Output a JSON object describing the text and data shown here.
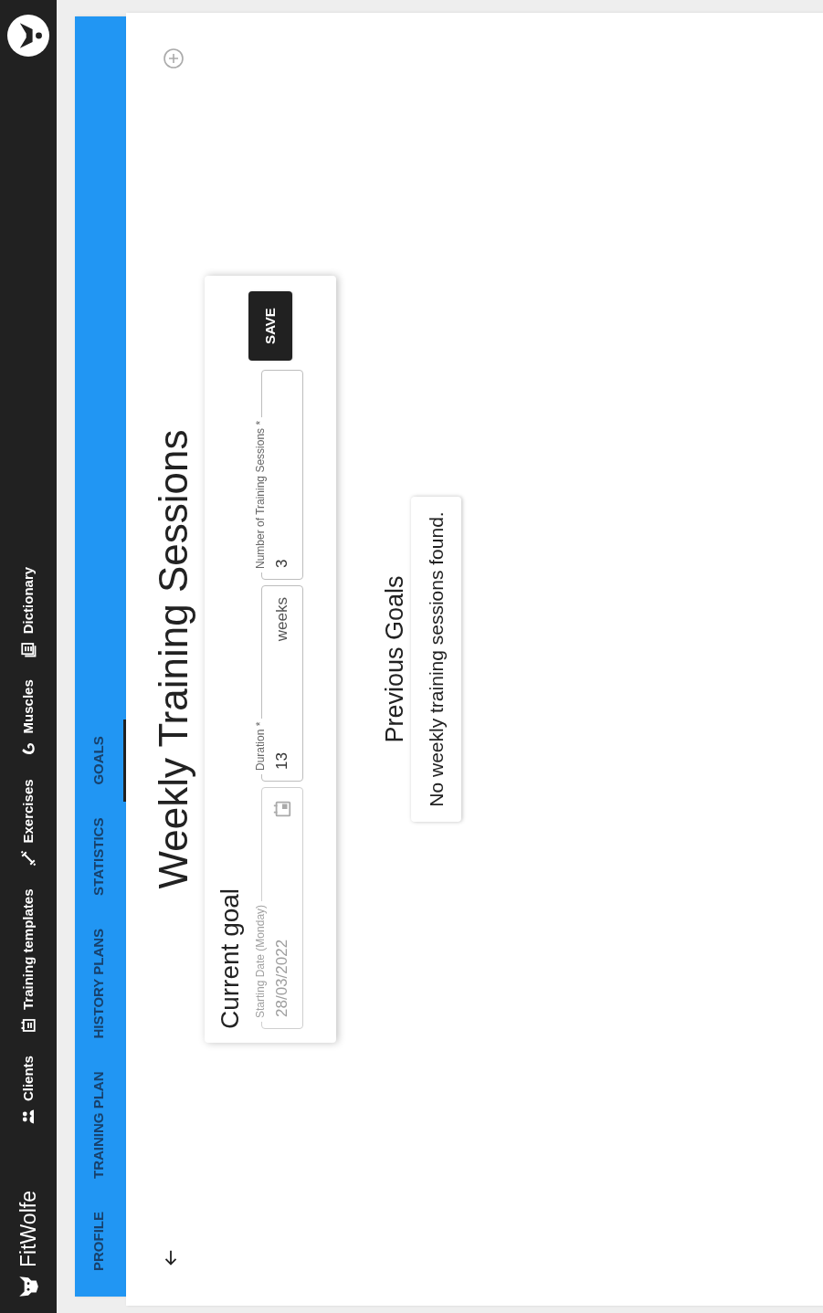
{
  "navbar": {
    "brand": "FitWolfe",
    "links": [
      {
        "label": "Clients"
      },
      {
        "label": "Training templates"
      },
      {
        "label": "Exercises"
      },
      {
        "label": "Muscles"
      },
      {
        "label": "Dictionary"
      }
    ]
  },
  "tabs": [
    {
      "label": "PROFILE",
      "selected": false
    },
    {
      "label": "TRAINING PLAN",
      "selected": false
    },
    {
      "label": "HISTORY PLANS",
      "selected": false
    },
    {
      "label": "STATISTICS",
      "selected": false
    },
    {
      "label": "GOALS",
      "selected": true
    }
  ],
  "page_title": "Weekly Training Sessions",
  "current_goal": {
    "title": "Current goal",
    "fields": [
      {
        "kind": "date",
        "label": "Starting Date (Monday)",
        "value": "28/03/2022",
        "disabled": true
      },
      {
        "kind": "suffix",
        "label": "Duration *",
        "value": "13",
        "suffix": "weeks",
        "disabled": false
      },
      {
        "kind": "number",
        "label": "Number of Training Sessions *",
        "value": "3",
        "disabled": false
      }
    ],
    "save_button": "SAVE"
  },
  "previous_goals": {
    "title": "Previous Goals",
    "empty_message": "No weekly training sessions found."
  }
}
